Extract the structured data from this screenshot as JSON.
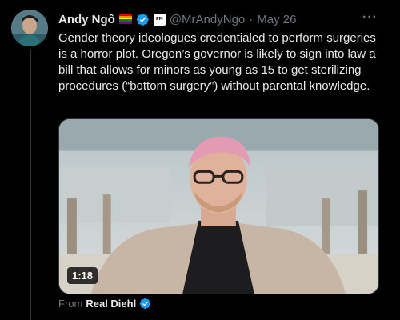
{
  "tweet": {
    "author": {
      "display_name": "Andy Ngô",
      "handle": "@MrAndyNgo",
      "affiliation_badge": "PM",
      "verified_icon": "verified-badge-icon",
      "flag_icon": "rainbow-flag-icon"
    },
    "separator": "·",
    "date": "May 26",
    "more_icon": "more-icon",
    "text": "Gender theory ideologues credentialed to perform surgeries is a horror plot. Oregon’s governor is likely to sign into law a bill that allows for minors as young as 15 to get sterilizing procedures (“bottom surgery”) without parental knowledge.",
    "media": {
      "type": "video",
      "duration": "1:18"
    },
    "source": {
      "prefix": "From",
      "name": "Real Diehl"
    }
  },
  "colors": {
    "background": "#000000",
    "text": "#e7e9ea",
    "secondary_text": "#71767b",
    "verified_blue": "#1d9bf0",
    "border": "#2f3336"
  }
}
